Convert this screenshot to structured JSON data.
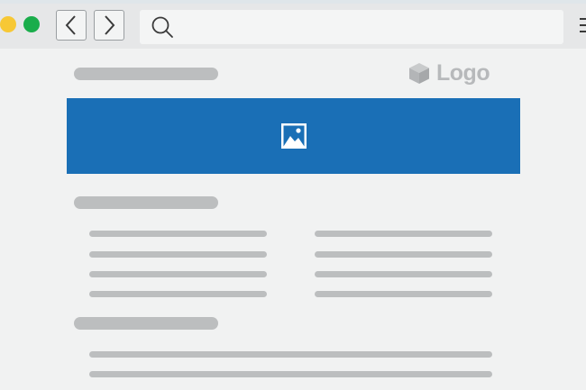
{
  "browser": {
    "traffic_lights": {
      "yellow": "#f7c835",
      "green": "#1aad4b"
    },
    "nav": {
      "back_icon": "chevron-left-icon",
      "forward_icon": "chevron-right-icon"
    },
    "address_bar": {
      "icon": "search-icon",
      "value": ""
    },
    "menu_icon": "hamburger-menu-icon"
  },
  "page": {
    "logo": {
      "text": "Logo",
      "icon": "cube-icon",
      "color": "#b7b9bb"
    },
    "hero": {
      "color": "#1a6fb6",
      "icon": "image-icon"
    },
    "placeholder_color": "#bcbebf"
  }
}
